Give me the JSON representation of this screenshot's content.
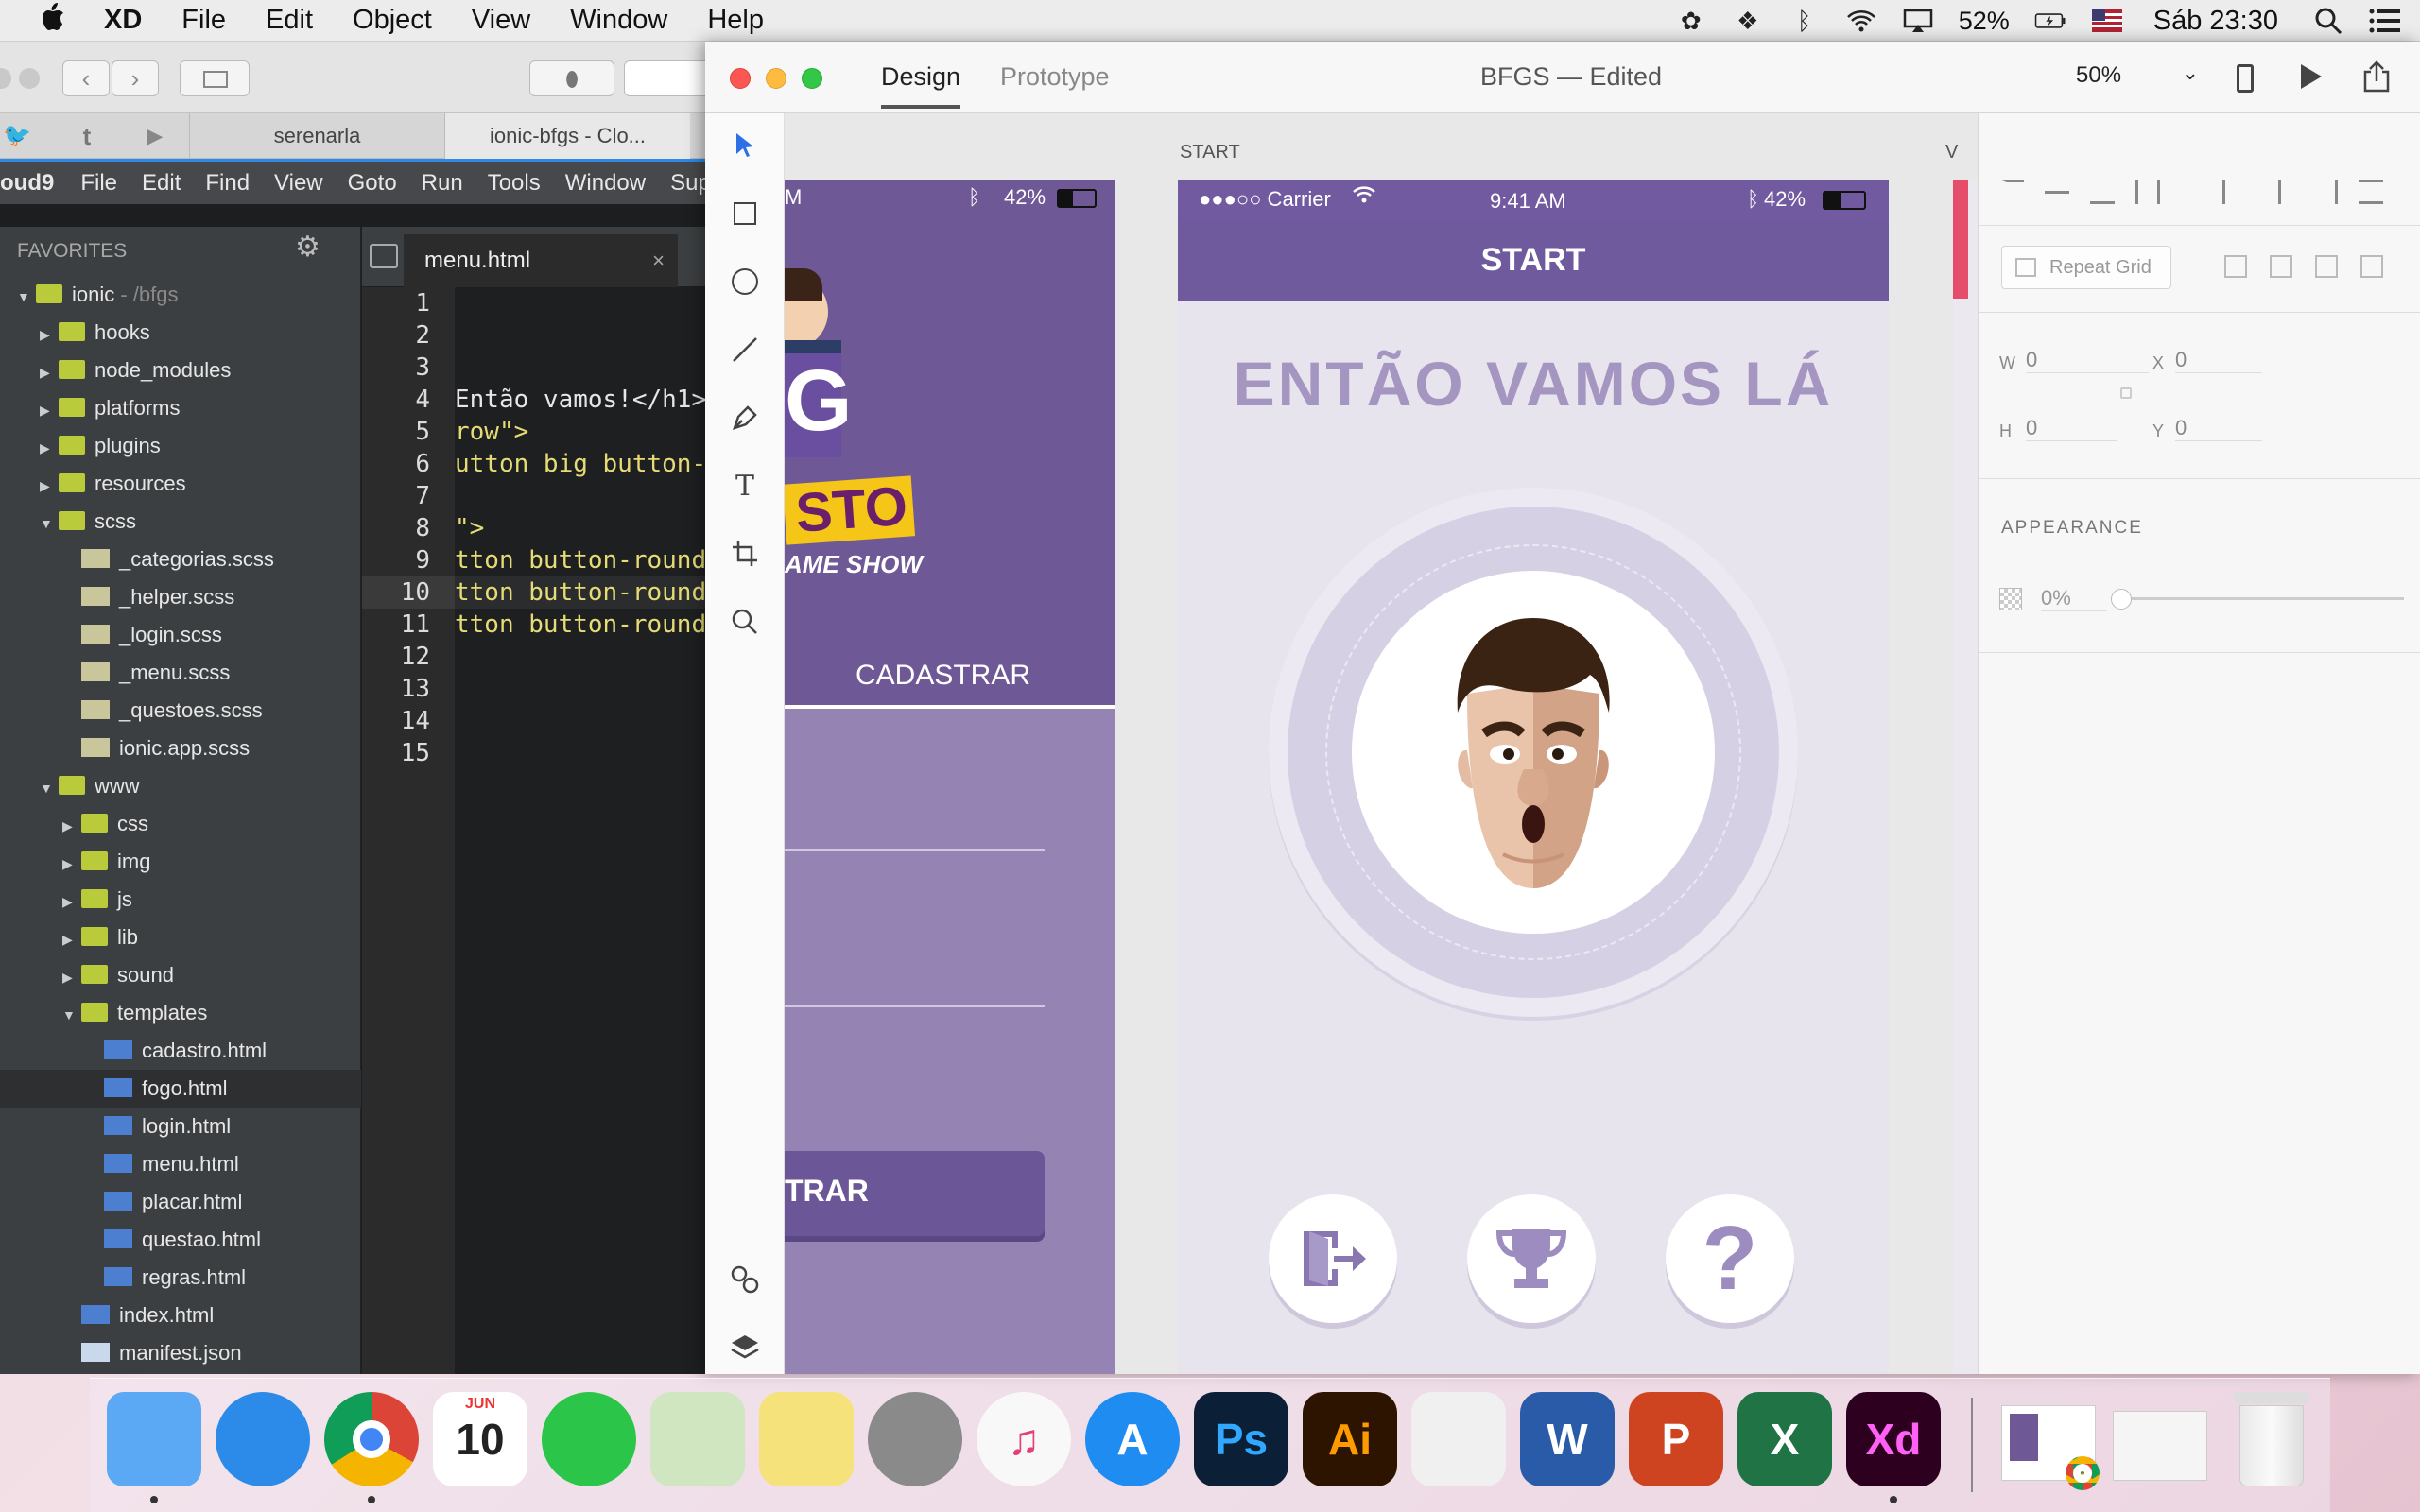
{
  "menubar": {
    "app_name": "XD",
    "items": [
      "File",
      "Edit",
      "Object",
      "View",
      "Window",
      "Help"
    ],
    "battery": "52%",
    "clock": "Sáb 23:30"
  },
  "brackets": {
    "tabs": [
      "serenarla",
      "ionic-bfgs - Clo..."
    ],
    "app_title_fragment": "oud9",
    "menu": [
      "File",
      "Edit",
      "Find",
      "View",
      "Goto",
      "Run",
      "Tools",
      "Window",
      "Sup"
    ],
    "favorites_label": "FAVORITES",
    "root_folder": "ionic",
    "root_path": " - /bfgs",
    "tree": [
      {
        "label": "hooks",
        "type": "folder",
        "depth": 1,
        "open": false
      },
      {
        "label": "node_modules",
        "type": "folder",
        "depth": 1,
        "open": false
      },
      {
        "label": "platforms",
        "type": "folder",
        "depth": 1,
        "open": false
      },
      {
        "label": "plugins",
        "type": "folder",
        "depth": 1,
        "open": false
      },
      {
        "label": "resources",
        "type": "folder",
        "depth": 1,
        "open": false
      },
      {
        "label": "scss",
        "type": "folder",
        "depth": 1,
        "open": true
      },
      {
        "label": "_categorias.scss",
        "type": "css",
        "depth": 2
      },
      {
        "label": "_helper.scss",
        "type": "css",
        "depth": 2
      },
      {
        "label": "_login.scss",
        "type": "css",
        "depth": 2
      },
      {
        "label": "_menu.scss",
        "type": "css",
        "depth": 2
      },
      {
        "label": "_questoes.scss",
        "type": "css",
        "depth": 2
      },
      {
        "label": "ionic.app.scss",
        "type": "css",
        "depth": 2
      },
      {
        "label": "www",
        "type": "folder",
        "depth": 1,
        "open": true
      },
      {
        "label": "css",
        "type": "folder",
        "depth": 2,
        "open": false
      },
      {
        "label": "img",
        "type": "folder",
        "depth": 2,
        "open": false
      },
      {
        "label": "js",
        "type": "folder",
        "depth": 2,
        "open": false
      },
      {
        "label": "lib",
        "type": "folder",
        "depth": 2,
        "open": false
      },
      {
        "label": "sound",
        "type": "folder",
        "depth": 2,
        "open": false
      },
      {
        "label": "templates",
        "type": "folder",
        "depth": 2,
        "open": true
      },
      {
        "label": "cadastro.html",
        "type": "html",
        "depth": 3
      },
      {
        "label": "fogo.html",
        "type": "html",
        "depth": 3,
        "selected": true
      },
      {
        "label": "login.html",
        "type": "html",
        "depth": 3
      },
      {
        "label": "menu.html",
        "type": "html",
        "depth": 3
      },
      {
        "label": "placar.html",
        "type": "html",
        "depth": 3
      },
      {
        "label": "questao.html",
        "type": "html",
        "depth": 3
      },
      {
        "label": "regras.html",
        "type": "html",
        "depth": 3
      },
      {
        "label": "index.html",
        "type": "html",
        "depth": 2
      },
      {
        "label": "manifest.json",
        "type": "json",
        "depth": 2
      }
    ],
    "editor_tab": "menu.html",
    "line_numbers": [
      "1",
      "2",
      "3",
      "4",
      "5",
      "6",
      "7",
      "8",
      "9",
      "10",
      "11",
      "12",
      "13",
      "14",
      "15"
    ],
    "code_lines": [
      "",
      "",
      "",
      "Então vamos!</h1>",
      "row\">",
      "utton big button-",
      "",
      "\">",
      "tton button-round",
      "tton button-round",
      "tton button-round",
      "",
      "",
      "",
      ""
    ]
  },
  "xd": {
    "tab_design": "Design",
    "tab_prototype": "Prototype",
    "doc_title": "BFGS — Edited",
    "zoom": "50%",
    "artboard_label": "START",
    "artboard_label_right": "V",
    "status_bar": {
      "carrier": "●●●○○ Carrier",
      "time": "9:41 AM",
      "battery": "42%"
    },
    "left_artboard": {
      "logo_fragment_1": "G",
      "logo_fragment_2": "STO",
      "logo_fragment_3": "AME SHOW",
      "cadastrar_tab": "CADASTRAR",
      "button_fragment": "TRAR",
      "battery": "42%",
      "time_fragment": "M"
    },
    "screen_title": "START",
    "heading": "ENTÃO VAMOS LÁ",
    "bottom_buttons": [
      "exit-icon",
      "trophy-icon",
      "help-icon"
    ],
    "help_glyph": "?",
    "right_panel": {
      "repeat_grid": "Repeat Grid",
      "w_label": "W",
      "w_value": "0",
      "h_label": "H",
      "h_value": "0",
      "x_label": "X",
      "x_value": "0",
      "y_label": "Y",
      "y_value": "0",
      "appearance": "APPEARANCE",
      "opacity": "0%"
    }
  },
  "dock": {
    "apps": [
      {
        "name": "Finder",
        "glyph": "",
        "color": "#5ba8f5"
      },
      {
        "name": "Safari",
        "glyph": "",
        "color": "#2c8be8"
      },
      {
        "name": "Chrome",
        "glyph": "",
        "color": "#ffffff"
      },
      {
        "name": "Calendar",
        "glyph": "10",
        "color": "#ffffff",
        "sub": "JUN"
      },
      {
        "name": "WhatsApp",
        "glyph": "",
        "color": "#2bc54a"
      },
      {
        "name": "Maps",
        "glyph": "",
        "color": "#cfe6c0"
      },
      {
        "name": "Notes",
        "glyph": "",
        "color": "#f6e27a"
      },
      {
        "name": "System Preferences",
        "glyph": "",
        "color": "#8a8a8a"
      },
      {
        "name": "iTunes",
        "glyph": "♫",
        "color": "#f8f8f8"
      },
      {
        "name": "App Store",
        "glyph": "A",
        "color": "#1e8cf0"
      },
      {
        "name": "Photoshop",
        "glyph": "Ps",
        "color": "#0b1f37"
      },
      {
        "name": "Illustrator",
        "glyph": "Ai",
        "color": "#2d1400"
      },
      {
        "name": "TextEdit",
        "glyph": "",
        "color": "#f0f0f0"
      },
      {
        "name": "Word",
        "glyph": "W",
        "color": "#2a5ba8"
      },
      {
        "name": "PowerPoint",
        "glyph": "P",
        "color": "#cf4420"
      },
      {
        "name": "Excel",
        "glyph": "X",
        "color": "#1f7345"
      },
      {
        "name": "Adobe XD",
        "glyph": "Xd",
        "color": "#2e001f"
      }
    ]
  }
}
